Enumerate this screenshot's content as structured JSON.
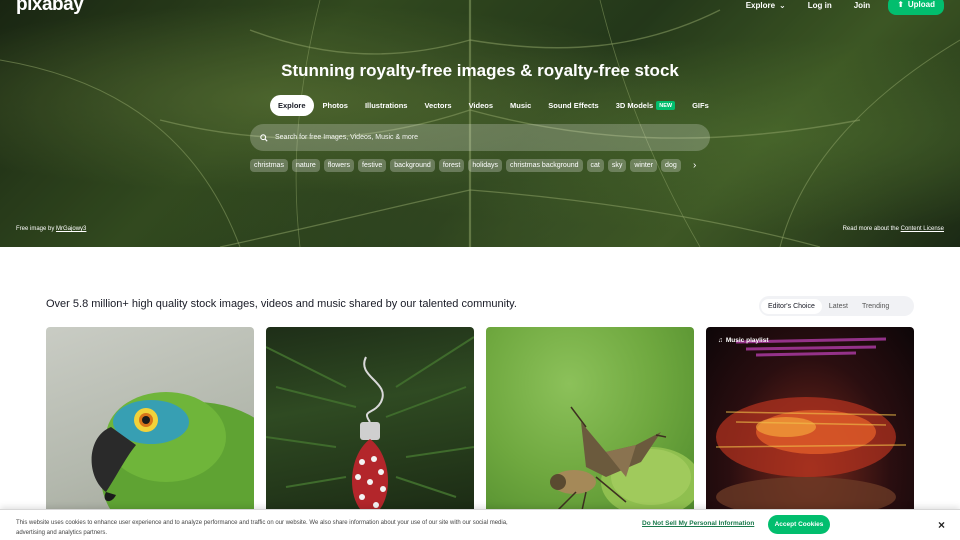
{
  "header": {
    "logo": "pixabay",
    "nav": {
      "explore": "Explore",
      "login": "Log in",
      "join": "Join",
      "upload": "Upload"
    }
  },
  "hero": {
    "headline": "Stunning royalty-free images & royalty-free stock",
    "tabs": [
      {
        "label": "Explore",
        "active": true
      },
      {
        "label": "Photos"
      },
      {
        "label": "Illustrations"
      },
      {
        "label": "Vectors"
      },
      {
        "label": "Videos"
      },
      {
        "label": "Music"
      },
      {
        "label": "Sound Effects"
      },
      {
        "label": "3D Models",
        "badge": "NEW"
      },
      {
        "label": "GIFs"
      }
    ],
    "search_placeholder": "Search for free Images, Videos, Music & more",
    "chips": [
      "christmas",
      "nature",
      "flowers",
      "festive",
      "background",
      "forest",
      "holidays",
      "christmas background",
      "cat",
      "sky",
      "winter",
      "dog"
    ],
    "credit_prefix": "Free image by",
    "credit_user": "MrGajowy3",
    "license_prefix": "Read more about the",
    "license_link": "Content License"
  },
  "main": {
    "tagline": "Over 5.8 million+ high quality stock images, videos and music shared by our talented community.",
    "sort_options": [
      {
        "label": "Editor's Choice",
        "active": true
      },
      {
        "label": "Latest"
      },
      {
        "label": "Trending"
      }
    ],
    "playlist_label": "Music playlist"
  },
  "cookie": {
    "text": "This website uses cookies to enhance user experience and to analyze performance and traffic on our website. We also share information about your use of our site with our social media, advertising and analytics partners.",
    "link": "Do Not Sell My Personal Information",
    "accept": "Accept Cookies",
    "close": "×"
  },
  "colors": {
    "accent": "#02be6e",
    "text": "#191b26"
  }
}
